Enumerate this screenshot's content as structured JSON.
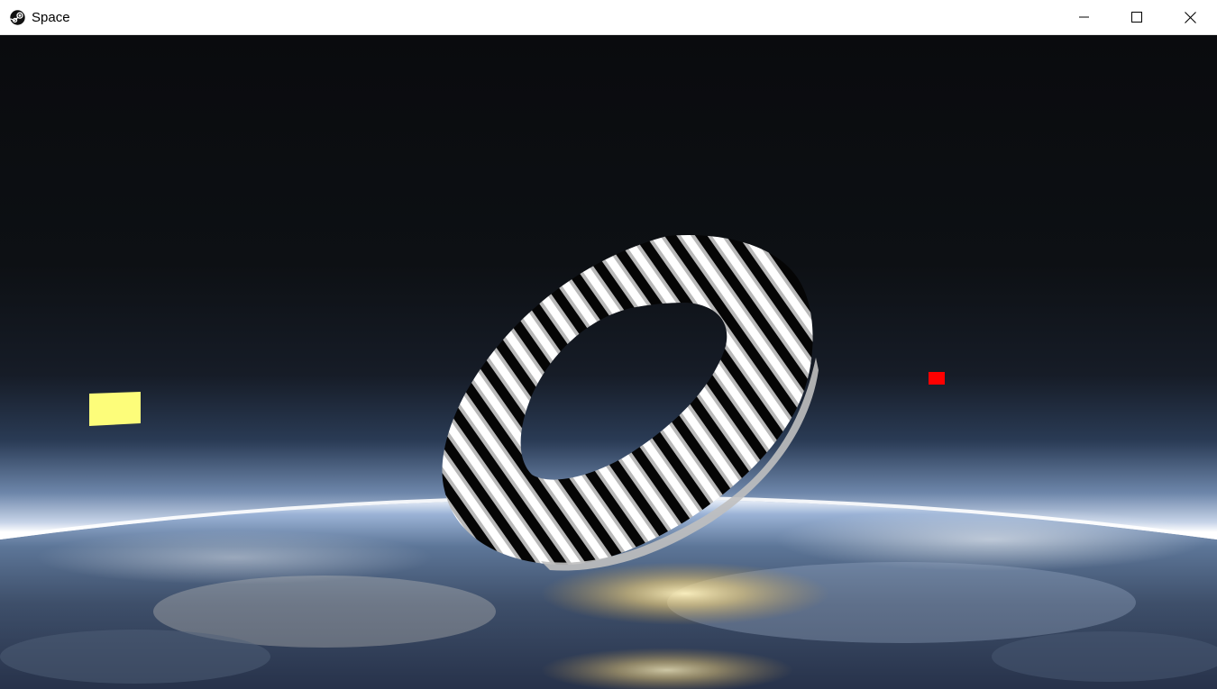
{
  "window": {
    "title": "Space",
    "icon": "steam-icon",
    "controls": {
      "minimize_icon": "minimize-icon",
      "maximize_icon": "maximize-icon",
      "close_icon": "close-icon"
    }
  },
  "scene": {
    "objects": [
      {
        "name": "striped-torus",
        "pattern": "black-white-stripes"
      },
      {
        "name": "yellow-cube",
        "color": "#fdfd7a"
      },
      {
        "name": "red-cube",
        "color": "#ff0000"
      }
    ],
    "background": "earth-from-space"
  }
}
